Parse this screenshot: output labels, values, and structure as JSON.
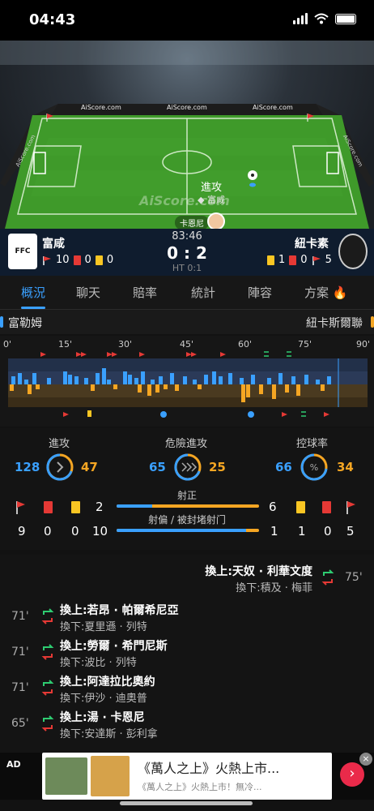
{
  "status_bar": {
    "time": "04:43"
  },
  "pitch": {
    "ad_boards": [
      "AiScore.com",
      "AiScore.com",
      "AiScore.com"
    ],
    "side_boards": [
      "AiScore.com",
      "AiScore.com"
    ],
    "watermark": "AiScore.com",
    "event": "進攻",
    "event_team": "富咸",
    "player": "卡恩尼"
  },
  "score": {
    "minute": "83:46",
    "score": "0 : 2",
    "half_time": "HT 0:1",
    "home": {
      "name": "富咸",
      "corners": "10",
      "red": "0",
      "yellow": "0"
    },
    "away": {
      "name": "紐卡素",
      "yellow": "1",
      "red": "0",
      "corners": "5"
    }
  },
  "tabs": [
    "概況",
    "聊天",
    "賠率",
    "統計",
    "陣容",
    "方案"
  ],
  "tabs_active": "概況",
  "teams": {
    "home": "富勒姆",
    "away": "紐卡斯爾聯"
  },
  "timeline": {
    "ticks": [
      "0'",
      "15'",
      "30'",
      "45'",
      "60'",
      "75'",
      "90'"
    ]
  },
  "stats": {
    "attack": {
      "title": "進攻",
      "home": "128",
      "away": "47",
      "home_share": 0.73
    },
    "danger": {
      "title": "危險進攻",
      "home": "65",
      "away": "25",
      "home_share": 0.72
    },
    "possession": {
      "title": "控球率",
      "home": "66",
      "away": "34",
      "home_share": 0.66
    },
    "shots_on": {
      "label": "射正",
      "home": "2",
      "away": "6",
      "home_share": 0.25
    },
    "shots_off": {
      "label": "射偏 / 被封堵射门",
      "home": "10",
      "away": "1",
      "home_share": 0.91
    },
    "home_corners": "9",
    "home_red": "0",
    "home_yellow": "0",
    "away_yellow": "1",
    "away_red": "0",
    "away_corners": "5"
  },
  "substitutions": [
    {
      "side": "away",
      "minute": "75'",
      "in": "換上:天奴 · 利華文度",
      "out": "換下:積及 · 梅菲"
    },
    {
      "side": "home",
      "minute": "71'",
      "in": "換上:若昂 · 帕爾希尼亞",
      "out": "換下:夏里遜 · 列特"
    },
    {
      "side": "home",
      "minute": "71'",
      "in": "換上:勞爾 · 希門尼斯",
      "out": "換下:波比 · 列特"
    },
    {
      "side": "home",
      "minute": "71'",
      "in": "換上:阿達拉比奧約",
      "out": "換下:伊沙 · 迪奧普"
    },
    {
      "side": "home",
      "minute": "65'",
      "in": "換上:湯 · 卡恩尼",
      "out": "換下:安達斯 · 彭利拿"
    }
  ],
  "ad": {
    "label": "AD",
    "title": "《萬人之上》火熱上市...",
    "subtitle": "《萬人之上》火熱上市！無冷..."
  }
}
